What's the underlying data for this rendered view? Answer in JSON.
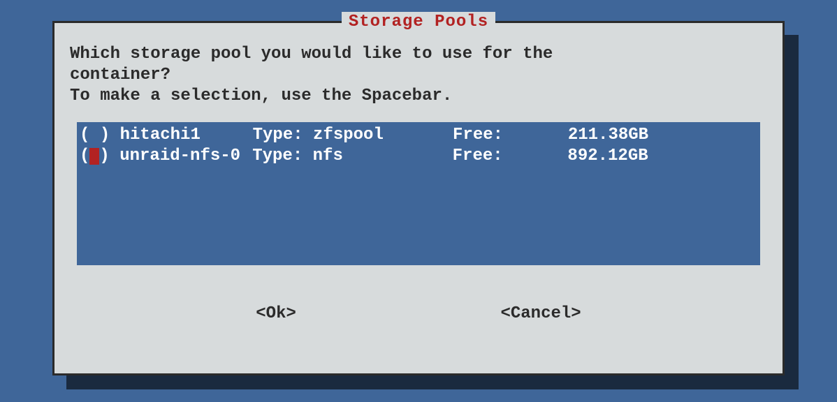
{
  "colors": {
    "background": "#3f6699",
    "panel": "#d7dbdc",
    "border": "#2b2b2b",
    "title": "#b22222",
    "listbox_bg": "#3f6699",
    "listbox_fg": "#ffffff",
    "cursor": "#b22222",
    "shadow": "#1a2a3f"
  },
  "dialog": {
    "title": "Storage Pools",
    "prompt_line1": "Which storage pool you would like to use for the",
    "prompt_line2": "container?",
    "prompt_line3": "To make a selection, use the Spacebar."
  },
  "list": {
    "type_label": "Type: ",
    "free_label": "Free:",
    "items": [
      {
        "selected": false,
        "focused": false,
        "name": "hitachi1",
        "type": "zfspool",
        "free": "211.38GB"
      },
      {
        "selected": false,
        "focused": true,
        "name": "unraid-nfs-0",
        "type": "nfs",
        "free": "892.12GB"
      }
    ]
  },
  "buttons": {
    "ok": "<Ok>",
    "cancel": "<Cancel>"
  }
}
